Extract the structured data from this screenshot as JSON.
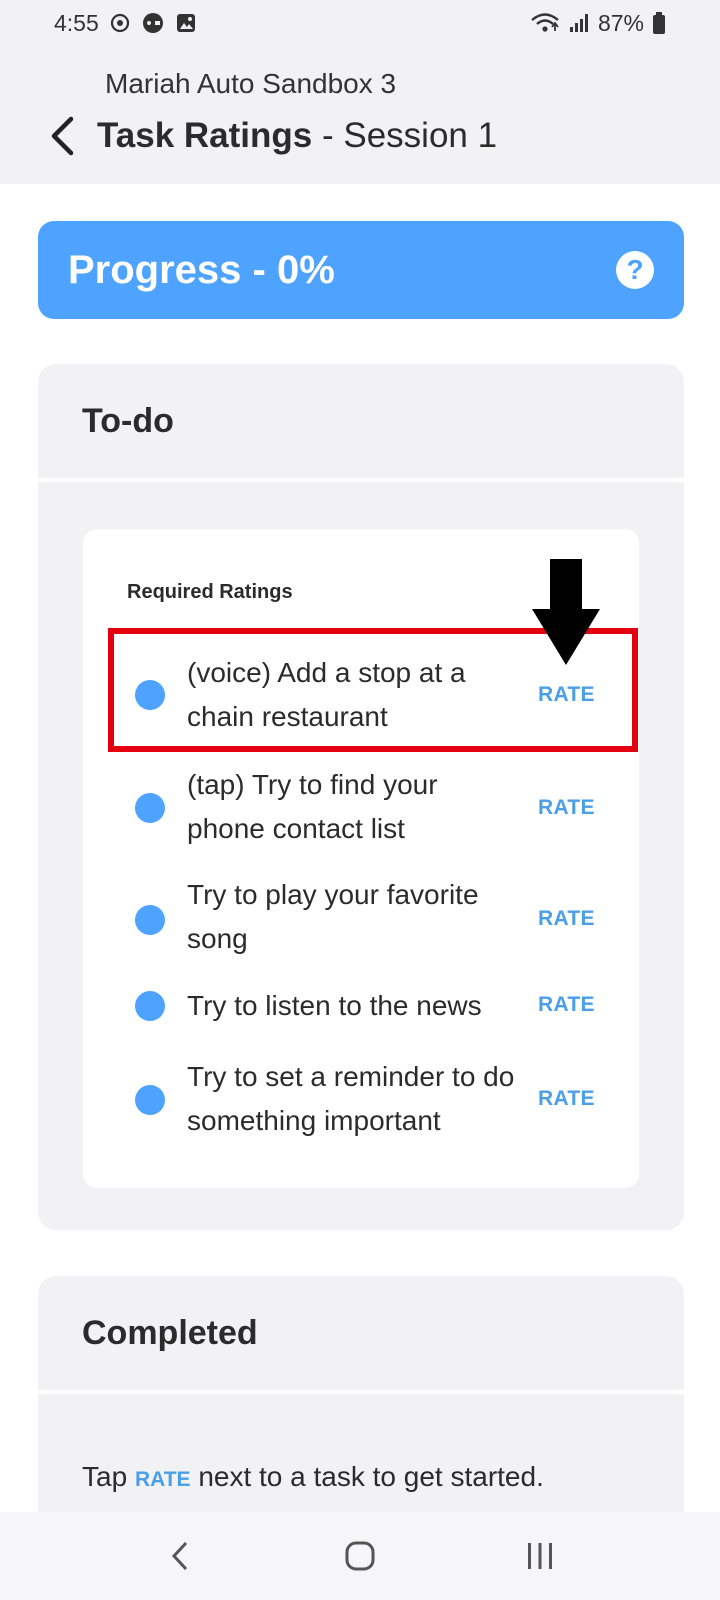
{
  "status_bar": {
    "time": "4:55",
    "battery": "87%",
    "icons": [
      "sync-icon",
      "game-icon",
      "image-icon",
      "wifi-icon",
      "signal-icon",
      "battery-icon"
    ]
  },
  "header": {
    "app_name": "Mariah Auto Sandbox 3",
    "title_bold": "Task Ratings",
    "title_rest": " - Session 1"
  },
  "progress": {
    "label": "Progress - 0%",
    "value_percent": 0,
    "help_glyph": "?"
  },
  "todo": {
    "heading": "To-do",
    "required_label": "Required Ratings",
    "tasks": [
      {
        "text": "(voice) Add a stop at a chain restaurant",
        "action": "RATE"
      },
      {
        "text": "(tap) Try to find your phone contact list",
        "action": "RATE"
      },
      {
        "text": "Try to play your favorite song",
        "action": "RATE"
      },
      {
        "text": "Try to listen to the news",
        "action": "RATE"
      },
      {
        "text": "Try to set a reminder to do something important",
        "action": "RATE"
      }
    ]
  },
  "completed": {
    "heading": "Completed",
    "hint_before": "Tap ",
    "hint_rate": "RATE",
    "hint_after": " next to a task to get started."
  },
  "colors": {
    "accent": "#4da3ff",
    "rate_text": "#4a9fe8",
    "highlight": "#e3000f",
    "card_bg": "#f2f2f5"
  }
}
